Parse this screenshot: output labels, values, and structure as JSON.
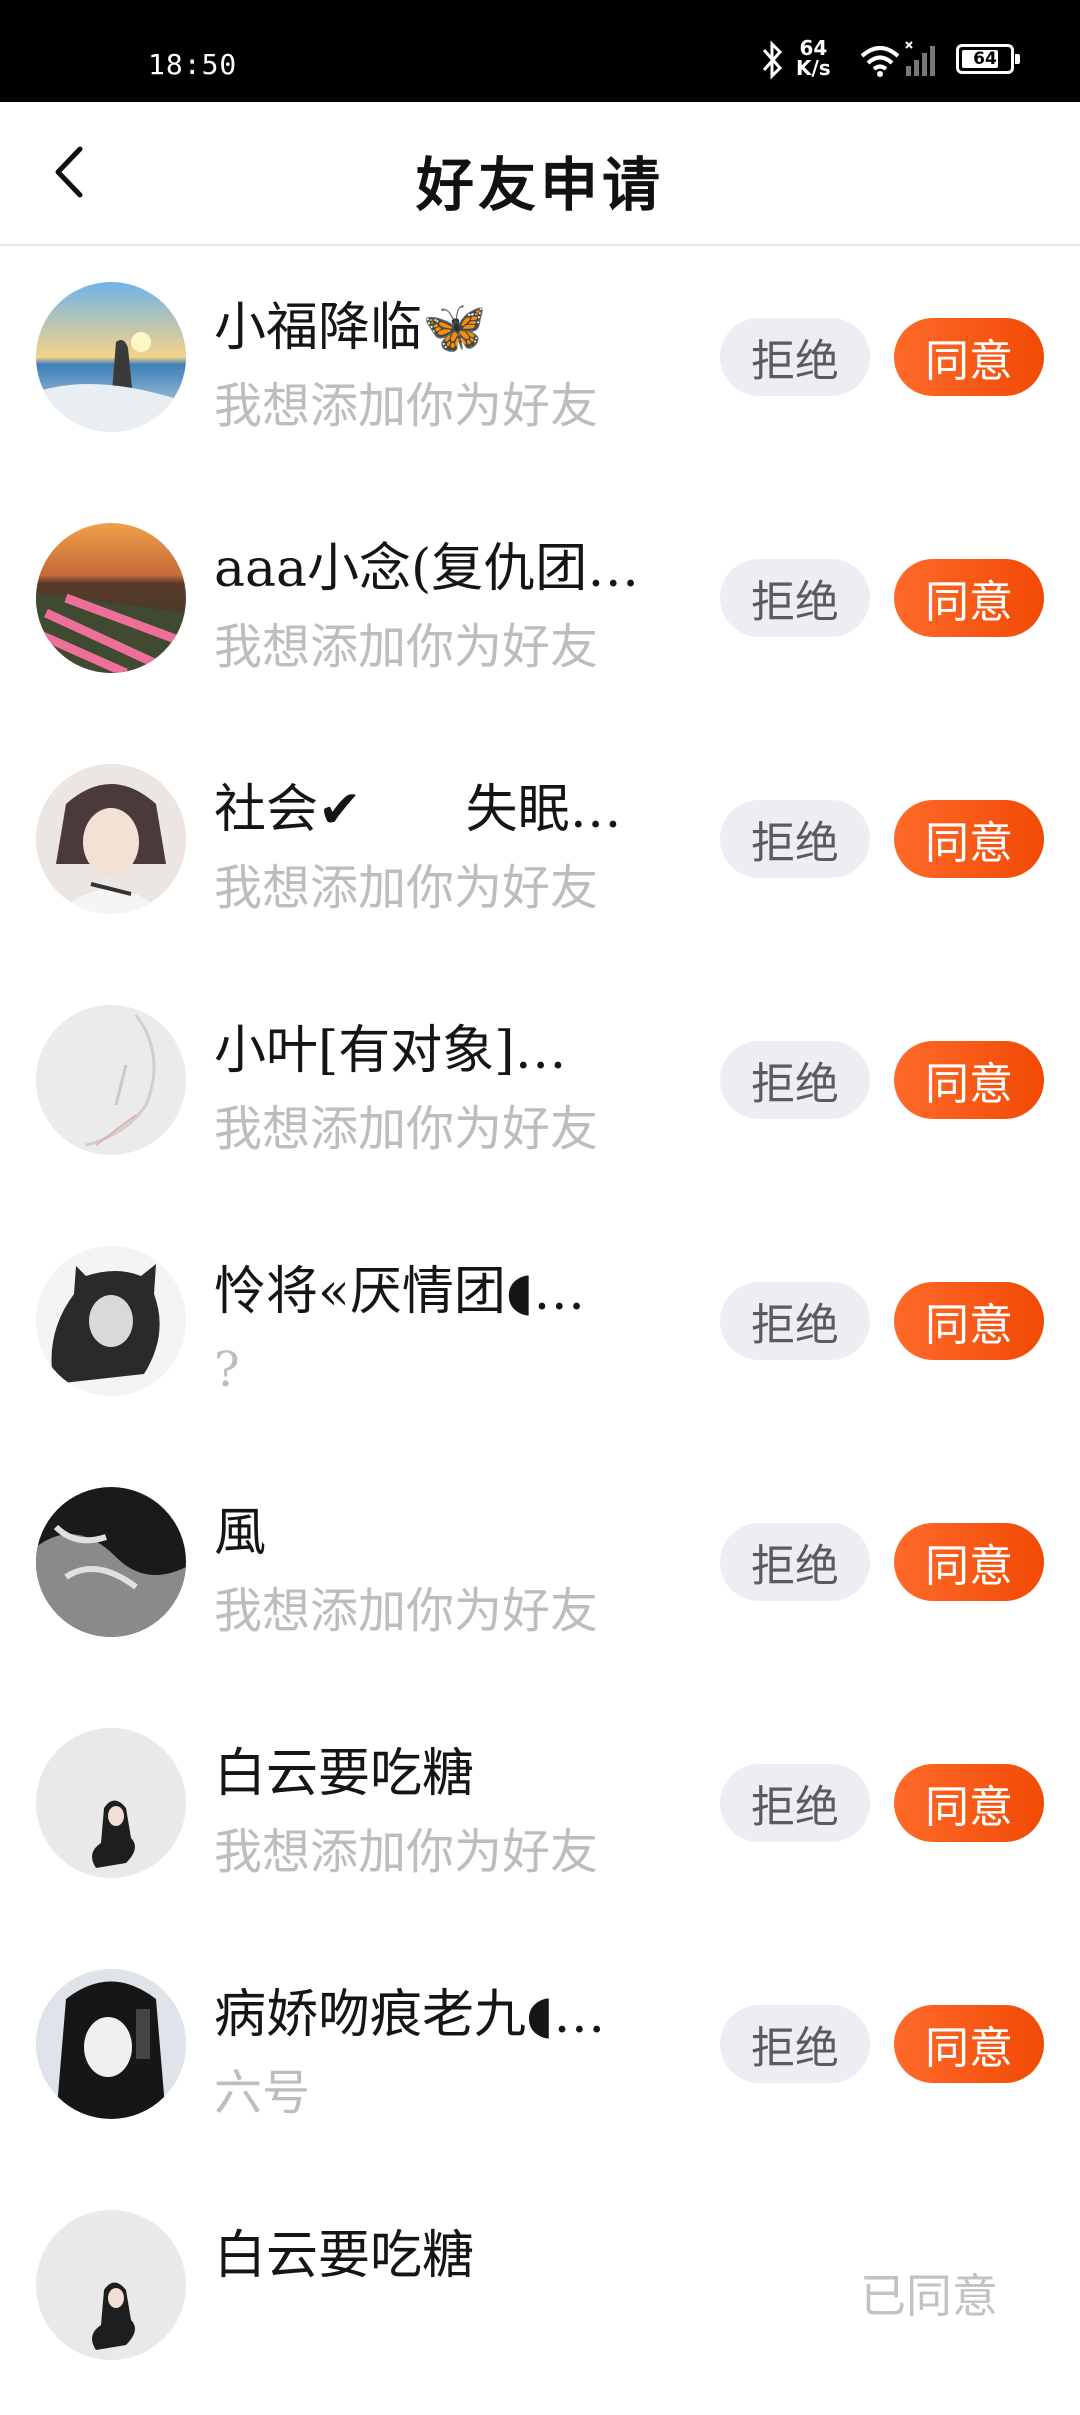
{
  "status_bar": {
    "time": "18:50",
    "net_speed_value": "64",
    "net_speed_unit": "K/s",
    "battery": "64",
    "icons": [
      "bluetooth-icon",
      "wifi-icon",
      "signal-icon",
      "battery-icon"
    ]
  },
  "header": {
    "title": "好友申请",
    "back_icon": "chevron-left-icon"
  },
  "buttons": {
    "reject": "拒绝",
    "accept": "同意"
  },
  "colors": {
    "accent_start": "#ff6a2a",
    "accent_end": "#f14a05",
    "reject_bg": "#eceef3"
  },
  "requests": [
    {
      "nickname": "小福降临🦋",
      "message": "我想添加你为好友",
      "state": "pending"
    },
    {
      "nickname": "aaa小念(复仇团…",
      "message": "我想添加你为好友",
      "state": "pending"
    },
    {
      "nickname": "社会✔　　失眠…",
      "message": "我想添加你为好友",
      "state": "pending"
    },
    {
      "nickname": "小叶[有对象]…",
      "message": "我想添加你为好友",
      "state": "pending"
    },
    {
      "nickname": "怜将«厌情团◖…",
      "message": "?",
      "state": "pending"
    },
    {
      "nickname": "風",
      "message": "我想添加你为好友",
      "state": "pending"
    },
    {
      "nickname": "白云要吃糖",
      "message": "我想添加你为好友",
      "state": "pending"
    },
    {
      "nickname": "病娇吻痕老九◖…",
      "message": "六号",
      "state": "pending"
    },
    {
      "nickname": "白云要吃糖",
      "message": "",
      "state": "accepted",
      "status_text": "已同意"
    }
  ]
}
